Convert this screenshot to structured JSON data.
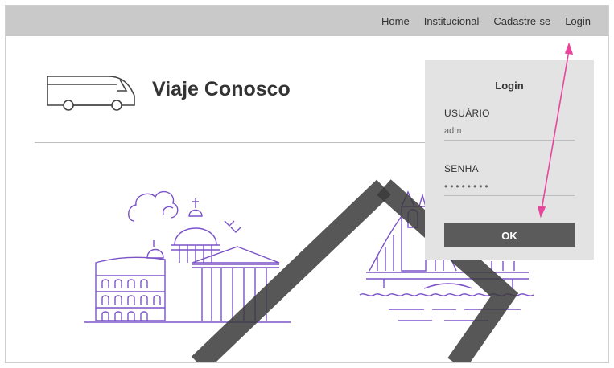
{
  "brand": {
    "name": "Viaje Conosco"
  },
  "nav": {
    "items": [
      {
        "label": "Home"
      },
      {
        "label": "Institucional"
      },
      {
        "label": "Cadastre-se"
      },
      {
        "label": "Login"
      }
    ]
  },
  "login": {
    "title": "Login",
    "user_label": "USUÁRIO",
    "user_value": "adm",
    "password_label": "SENHA",
    "password_value": "••••••••",
    "ok_label": "OK"
  },
  "colors": {
    "topbar": "#c9c9c9",
    "accent_purple": "#7b52c7",
    "annotation_pink": "#e8459c",
    "button": "#5b5b5b"
  },
  "icons": {
    "logo": "bus-icon",
    "landmarks_left": "rome-colosseum-pantheon-illustration",
    "landmarks_right": "bridge-tower-illustration"
  }
}
